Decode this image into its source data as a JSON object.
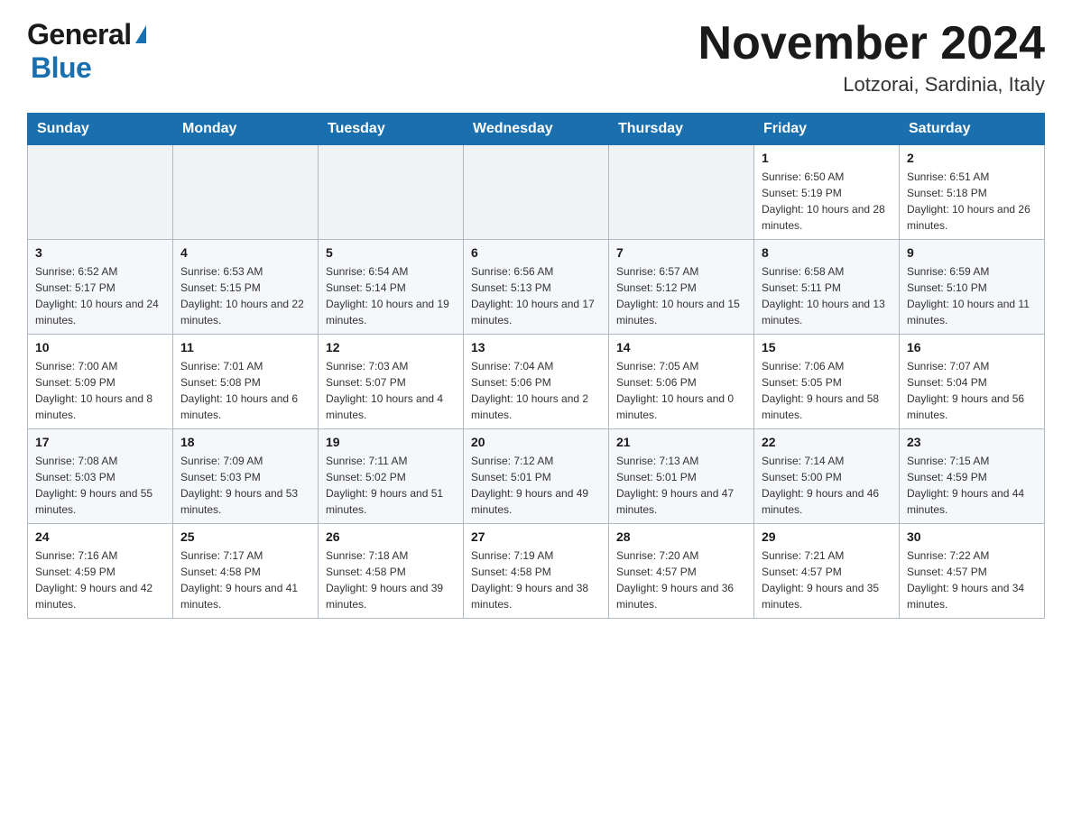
{
  "header": {
    "logo_general": "General",
    "logo_blue": "Blue",
    "month_title": "November 2024",
    "location": "Lotzorai, Sardinia, Italy"
  },
  "days_of_week": [
    "Sunday",
    "Monday",
    "Tuesday",
    "Wednesday",
    "Thursday",
    "Friday",
    "Saturday"
  ],
  "weeks": [
    {
      "days": [
        {
          "number": "",
          "info": ""
        },
        {
          "number": "",
          "info": ""
        },
        {
          "number": "",
          "info": ""
        },
        {
          "number": "",
          "info": ""
        },
        {
          "number": "",
          "info": ""
        },
        {
          "number": "1",
          "info": "Sunrise: 6:50 AM\nSunset: 5:19 PM\nDaylight: 10 hours and 28 minutes."
        },
        {
          "number": "2",
          "info": "Sunrise: 6:51 AM\nSunset: 5:18 PM\nDaylight: 10 hours and 26 minutes."
        }
      ]
    },
    {
      "days": [
        {
          "number": "3",
          "info": "Sunrise: 6:52 AM\nSunset: 5:17 PM\nDaylight: 10 hours and 24 minutes."
        },
        {
          "number": "4",
          "info": "Sunrise: 6:53 AM\nSunset: 5:15 PM\nDaylight: 10 hours and 22 minutes."
        },
        {
          "number": "5",
          "info": "Sunrise: 6:54 AM\nSunset: 5:14 PM\nDaylight: 10 hours and 19 minutes."
        },
        {
          "number": "6",
          "info": "Sunrise: 6:56 AM\nSunset: 5:13 PM\nDaylight: 10 hours and 17 minutes."
        },
        {
          "number": "7",
          "info": "Sunrise: 6:57 AM\nSunset: 5:12 PM\nDaylight: 10 hours and 15 minutes."
        },
        {
          "number": "8",
          "info": "Sunrise: 6:58 AM\nSunset: 5:11 PM\nDaylight: 10 hours and 13 minutes."
        },
        {
          "number": "9",
          "info": "Sunrise: 6:59 AM\nSunset: 5:10 PM\nDaylight: 10 hours and 11 minutes."
        }
      ]
    },
    {
      "days": [
        {
          "number": "10",
          "info": "Sunrise: 7:00 AM\nSunset: 5:09 PM\nDaylight: 10 hours and 8 minutes."
        },
        {
          "number": "11",
          "info": "Sunrise: 7:01 AM\nSunset: 5:08 PM\nDaylight: 10 hours and 6 minutes."
        },
        {
          "number": "12",
          "info": "Sunrise: 7:03 AM\nSunset: 5:07 PM\nDaylight: 10 hours and 4 minutes."
        },
        {
          "number": "13",
          "info": "Sunrise: 7:04 AM\nSunset: 5:06 PM\nDaylight: 10 hours and 2 minutes."
        },
        {
          "number": "14",
          "info": "Sunrise: 7:05 AM\nSunset: 5:06 PM\nDaylight: 10 hours and 0 minutes."
        },
        {
          "number": "15",
          "info": "Sunrise: 7:06 AM\nSunset: 5:05 PM\nDaylight: 9 hours and 58 minutes."
        },
        {
          "number": "16",
          "info": "Sunrise: 7:07 AM\nSunset: 5:04 PM\nDaylight: 9 hours and 56 minutes."
        }
      ]
    },
    {
      "days": [
        {
          "number": "17",
          "info": "Sunrise: 7:08 AM\nSunset: 5:03 PM\nDaylight: 9 hours and 55 minutes."
        },
        {
          "number": "18",
          "info": "Sunrise: 7:09 AM\nSunset: 5:03 PM\nDaylight: 9 hours and 53 minutes."
        },
        {
          "number": "19",
          "info": "Sunrise: 7:11 AM\nSunset: 5:02 PM\nDaylight: 9 hours and 51 minutes."
        },
        {
          "number": "20",
          "info": "Sunrise: 7:12 AM\nSunset: 5:01 PM\nDaylight: 9 hours and 49 minutes."
        },
        {
          "number": "21",
          "info": "Sunrise: 7:13 AM\nSunset: 5:01 PM\nDaylight: 9 hours and 47 minutes."
        },
        {
          "number": "22",
          "info": "Sunrise: 7:14 AM\nSunset: 5:00 PM\nDaylight: 9 hours and 46 minutes."
        },
        {
          "number": "23",
          "info": "Sunrise: 7:15 AM\nSunset: 4:59 PM\nDaylight: 9 hours and 44 minutes."
        }
      ]
    },
    {
      "days": [
        {
          "number": "24",
          "info": "Sunrise: 7:16 AM\nSunset: 4:59 PM\nDaylight: 9 hours and 42 minutes."
        },
        {
          "number": "25",
          "info": "Sunrise: 7:17 AM\nSunset: 4:58 PM\nDaylight: 9 hours and 41 minutes."
        },
        {
          "number": "26",
          "info": "Sunrise: 7:18 AM\nSunset: 4:58 PM\nDaylight: 9 hours and 39 minutes."
        },
        {
          "number": "27",
          "info": "Sunrise: 7:19 AM\nSunset: 4:58 PM\nDaylight: 9 hours and 38 minutes."
        },
        {
          "number": "28",
          "info": "Sunrise: 7:20 AM\nSunset: 4:57 PM\nDaylight: 9 hours and 36 minutes."
        },
        {
          "number": "29",
          "info": "Sunrise: 7:21 AM\nSunset: 4:57 PM\nDaylight: 9 hours and 35 minutes."
        },
        {
          "number": "30",
          "info": "Sunrise: 7:22 AM\nSunset: 4:57 PM\nDaylight: 9 hours and 34 minutes."
        }
      ]
    }
  ]
}
